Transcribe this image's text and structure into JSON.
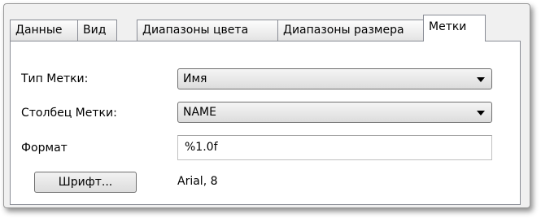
{
  "tabs": [
    {
      "label": "Данные"
    },
    {
      "label": "Вид"
    },
    {
      "label": "Диапазоны цвета"
    },
    {
      "label": "Диапазоны размера"
    },
    {
      "label": "Метки",
      "active": true
    }
  ],
  "labels_tab": {
    "label_type": {
      "caption": "Тип Метки:",
      "value": "Имя"
    },
    "label_column": {
      "caption": "Столбец Метки:",
      "value": "NAME"
    },
    "format": {
      "caption": "Формат",
      "value": "%1.0f"
    },
    "font_button": "Шрифт...",
    "font_value": "Arial, 8"
  }
}
